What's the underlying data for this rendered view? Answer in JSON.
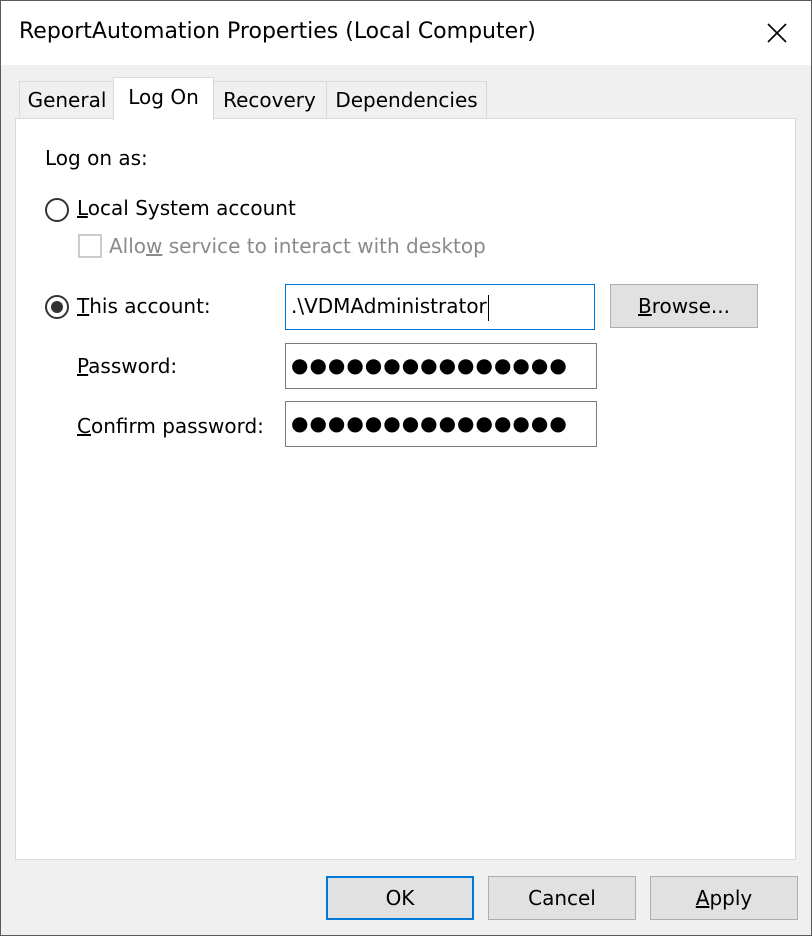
{
  "window": {
    "title": "ReportAutomation Properties (Local Computer)",
    "close_icon": "close-icon"
  },
  "tabs": [
    {
      "label": "General",
      "active": false
    },
    {
      "label": "Log On",
      "active": true
    },
    {
      "label": "Recovery",
      "active": false
    },
    {
      "label": "Dependencies",
      "active": false
    }
  ],
  "logon": {
    "heading": "Log on as:",
    "local_system": {
      "label_ul": "L",
      "label_rest": "ocal System account",
      "selected": false
    },
    "interact_desktop": {
      "label_pre": "Allo",
      "label_ul": "w",
      "label_post": " service to interact with desktop",
      "checked": false,
      "enabled": false
    },
    "this_account": {
      "label_ul": "T",
      "label_rest": "his account:",
      "selected": true,
      "value": ".\\VDMAdministrator"
    },
    "browse_button": {
      "label_ul": "B",
      "label_rest": "rowse..."
    },
    "password": {
      "label_ul": "P",
      "label_rest": "assword:",
      "value": "●●●●●●●●●●●●●●●"
    },
    "confirm_password": {
      "label_ul": "C",
      "label_rest": "onfirm password:",
      "value": "●●●●●●●●●●●●●●●"
    }
  },
  "buttons": {
    "ok": "OK",
    "cancel": "Cancel",
    "apply_ul": "A",
    "apply_rest": "pply"
  },
  "colors": {
    "focus_border": "#0078d7",
    "dialog_bg": "#f0f0f0",
    "panel_bg": "#ffffff"
  }
}
